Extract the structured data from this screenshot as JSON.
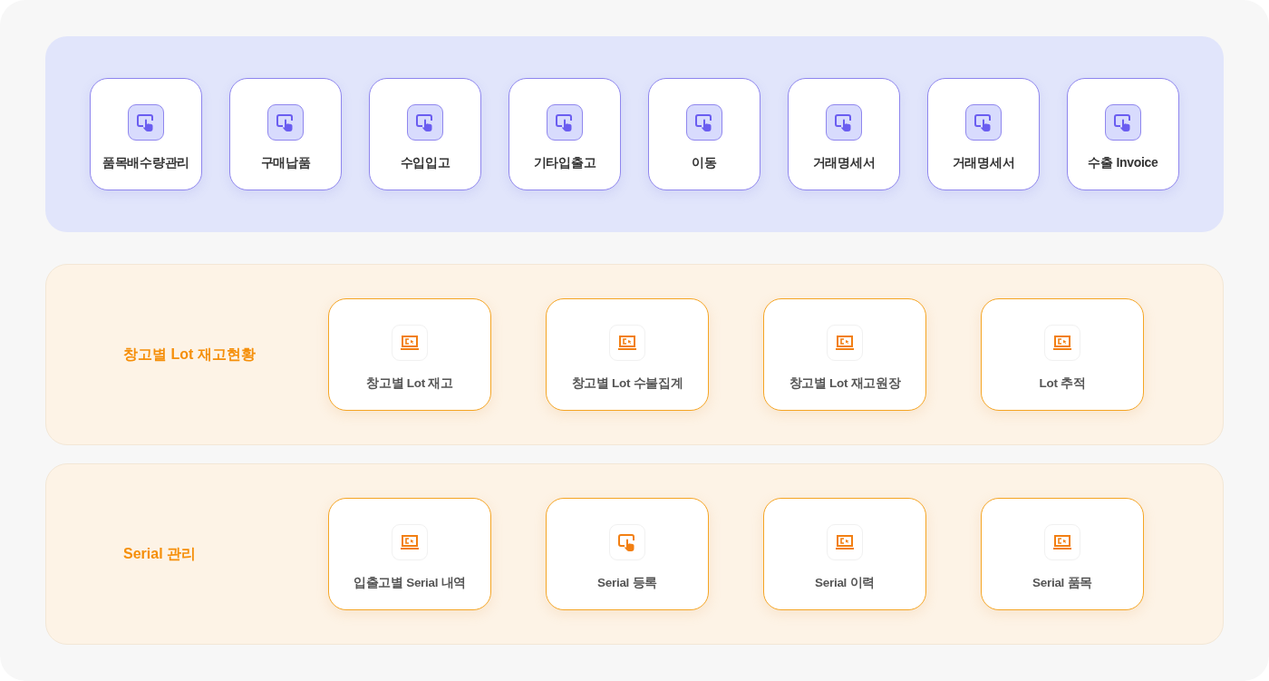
{
  "top_panel": {
    "items": [
      {
        "label": "품목배수량관리",
        "kind": "touch"
      },
      {
        "label": "구매납품",
        "kind": "touch"
      },
      {
        "label": "수입입고",
        "kind": "touch"
      },
      {
        "label": "기타입출고",
        "kind": "touch"
      },
      {
        "label": "이동",
        "kind": "touch"
      },
      {
        "label": "거래명세서",
        "kind": "touch"
      },
      {
        "label": "거래명세서",
        "kind": "touch"
      },
      {
        "label": "수출 Invoice",
        "kind": "touch"
      }
    ]
  },
  "sections": [
    {
      "title": "창고별 Lot 재고현황",
      "items": [
        {
          "label": "창고별 Lot 재고",
          "kind": "laptop"
        },
        {
          "label": "창고별 Lot 수불집계",
          "kind": "laptop"
        },
        {
          "label": "창고별 Lot 재고원장",
          "kind": "laptop"
        },
        {
          "label": "Lot 추적",
          "kind": "laptop"
        }
      ]
    },
    {
      "title": "Serial 관리",
      "items": [
        {
          "label": "입출고별 Serial 내역",
          "kind": "laptop"
        },
        {
          "label": "Serial 등록",
          "kind": "touch"
        },
        {
          "label": "Serial 이력",
          "kind": "laptop"
        },
        {
          "label": "Serial 품목",
          "kind": "laptop"
        }
      ]
    }
  ]
}
